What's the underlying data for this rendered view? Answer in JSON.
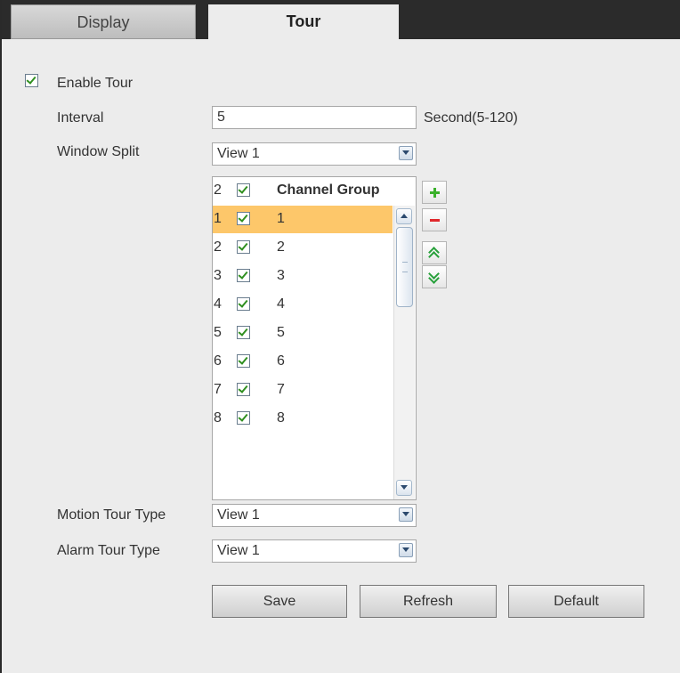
{
  "tabs": {
    "display": "Display",
    "tour": "Tour"
  },
  "enable_tour": {
    "label": "Enable Tour",
    "checked": true
  },
  "interval": {
    "label": "Interval",
    "value": "5",
    "unit": "Second(5-120)"
  },
  "window_split": {
    "label": "Window Split",
    "value": "View 1"
  },
  "channel_list": {
    "header": {
      "num": "2",
      "label": "Channel Group",
      "checked": true
    },
    "rows": [
      {
        "num": "1",
        "name": "1",
        "checked": true,
        "selected": true
      },
      {
        "num": "2",
        "name": "2",
        "checked": true
      },
      {
        "num": "3",
        "name": "3",
        "checked": true
      },
      {
        "num": "4",
        "name": "4",
        "checked": true
      },
      {
        "num": "5",
        "name": "5",
        "checked": true
      },
      {
        "num": "6",
        "name": "6",
        "checked": true
      },
      {
        "num": "7",
        "name": "7",
        "checked": true
      },
      {
        "num": "8",
        "name": "8",
        "checked": true
      }
    ]
  },
  "side_buttons": {
    "add": "plus-icon",
    "remove": "minus-icon",
    "move_up": "double-chevron-up-icon",
    "move_down": "double-chevron-down-icon"
  },
  "motion_tour_type": {
    "label": "Motion Tour Type",
    "value": "View 1"
  },
  "alarm_tour_type": {
    "label": "Alarm Tour Type",
    "value": "View 1"
  },
  "buttons": {
    "save": "Save",
    "refresh": "Refresh",
    "default": "Default"
  },
  "colors": {
    "selected_row": "#fdc76a",
    "tab_bar": "#2b2b2b",
    "panel": "#ececec",
    "check": "#2f8f1f"
  }
}
